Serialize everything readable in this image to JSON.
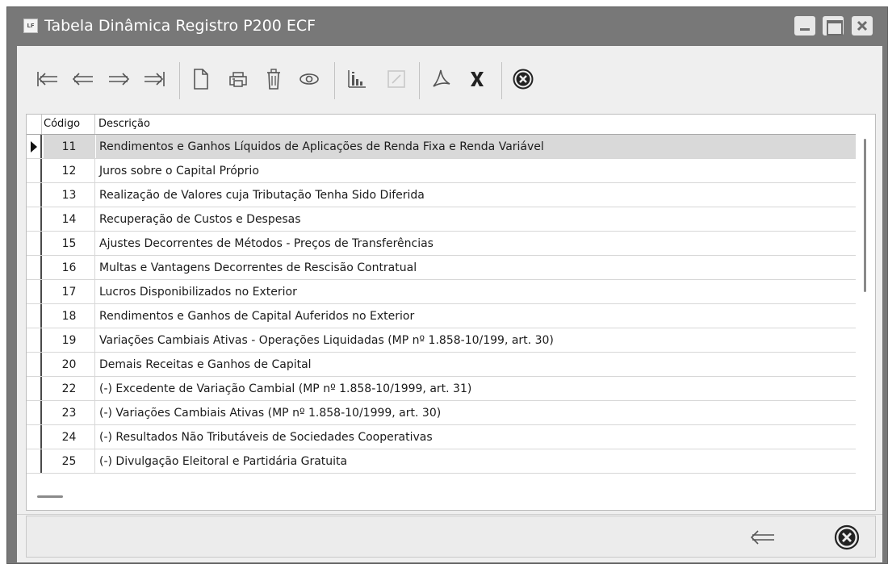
{
  "window": {
    "app_icon_text": "LF",
    "title": "Tabela Dinâmica Registro P200 ECF"
  },
  "toolbar": {
    "buttons": [
      {
        "name": "first-record",
        "icon": "arrow-to-first-icon",
        "enabled": true
      },
      {
        "name": "previous-record",
        "icon": "arrow-left-icon",
        "enabled": true
      },
      {
        "name": "next-record",
        "icon": "arrow-right-icon",
        "enabled": true
      },
      {
        "name": "last-record",
        "icon": "arrow-to-last-icon",
        "enabled": true
      },
      {
        "name": "new-record",
        "icon": "new-document-icon",
        "enabled": true
      },
      {
        "name": "print",
        "icon": "printer-icon",
        "enabled": true
      },
      {
        "name": "delete",
        "icon": "trash-icon",
        "enabled": true
      },
      {
        "name": "view",
        "icon": "eye-icon",
        "enabled": true
      },
      {
        "name": "chart",
        "icon": "chart-icon",
        "enabled": true
      },
      {
        "name": "edit",
        "icon": "edit-icon",
        "enabled": false
      },
      {
        "name": "pdf-export",
        "icon": "pdf-icon",
        "enabled": true
      },
      {
        "name": "excel-export",
        "icon": "excel-x-icon",
        "enabled": true
      },
      {
        "name": "close",
        "icon": "cancel-circle-icon",
        "enabled": true
      }
    ]
  },
  "grid": {
    "columns": [
      "Código",
      "Descrição"
    ],
    "selected_index": 0,
    "rows": [
      {
        "code": "11",
        "description": "Rendimentos e Ganhos Líquidos de Aplicações de Renda Fixa e Renda Variável"
      },
      {
        "code": "12",
        "description": "Juros sobre o Capital Próprio"
      },
      {
        "code": "13",
        "description": "Realização de Valores cuja Tributação Tenha Sido Diferida"
      },
      {
        "code": "14",
        "description": "Recuperação de Custos e Despesas"
      },
      {
        "code": "15",
        "description": "Ajustes Decorrentes de Métodos - Preços de Transferências"
      },
      {
        "code": "16",
        "description": "Multas e Vantagens Decorrentes de Rescisão Contratual"
      },
      {
        "code": "17",
        "description": "Lucros Disponibilizados no Exterior"
      },
      {
        "code": "18",
        "description": "Rendimentos e Ganhos de Capital Auferidos no Exterior"
      },
      {
        "code": "19",
        "description": "Variações Cambiais Ativas - Operações Liquidadas (MP nº 1.858-10/199, art. 30)"
      },
      {
        "code": "20",
        "description": "Demais Receitas e Ganhos de Capital"
      },
      {
        "code": "22",
        "description": "(-) Excedente de Variação Cambial (MP nº 1.858-10/1999, art. 31)"
      },
      {
        "code": "23",
        "description": "(-) Variações Cambiais Ativas (MP nº 1.858-10/1999, art. 30)"
      },
      {
        "code": "24",
        "description": "(-) Resultados Não Tributáveis de Sociedades Cooperativas"
      },
      {
        "code": "25",
        "description": "(-) Divulgação Eleitoral e Partidária Gratuita"
      }
    ]
  },
  "bottom_bar": {
    "buttons": [
      {
        "name": "back",
        "icon": "arrow-left-icon"
      },
      {
        "name": "exit",
        "icon": "cancel-circle-icon"
      }
    ]
  },
  "colors": {
    "titlebar": "#787878",
    "client_background": "#efefef",
    "selected_row": "#d9d9d9",
    "icon": "#555555",
    "icon_dark": "#222222"
  }
}
